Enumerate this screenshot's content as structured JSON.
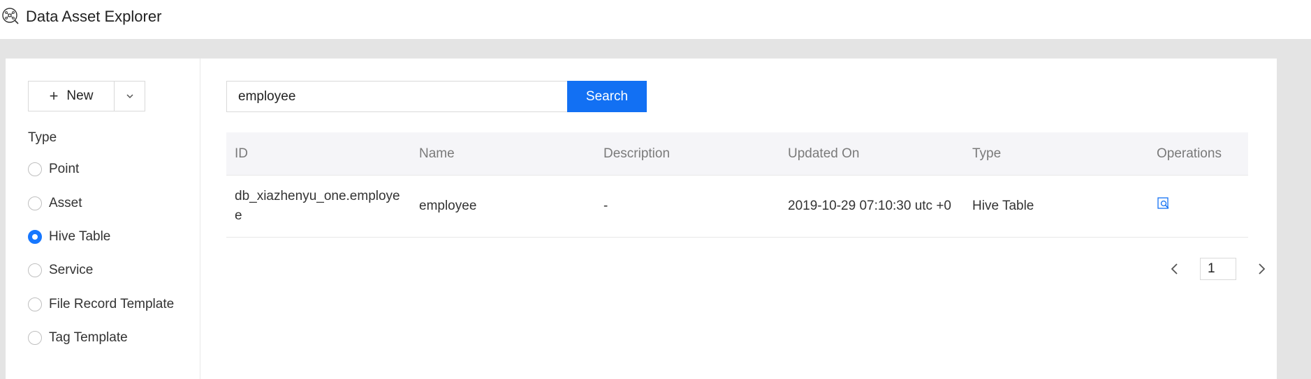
{
  "app": {
    "title": "Data Asset Explorer",
    "icon": "explorer-icon"
  },
  "sidebar": {
    "new_button": {
      "label": "New",
      "icon": "plus-icon",
      "dropdown_icon": "chevron-down-icon"
    },
    "type_heading": "Type",
    "types": [
      {
        "label": "Point",
        "checked": false
      },
      {
        "label": "Asset",
        "checked": false
      },
      {
        "label": "Hive Table",
        "checked": true
      },
      {
        "label": "Service",
        "checked": false
      },
      {
        "label": "File Record Template",
        "checked": false
      },
      {
        "label": "Tag Template",
        "checked": false
      }
    ]
  },
  "search": {
    "value": "employee",
    "button_label": "Search"
  },
  "table": {
    "columns": [
      "ID",
      "Name",
      "Description",
      "Updated On",
      "Type",
      "Operations"
    ],
    "rows": [
      {
        "id": "db_xiazhenyu_one.employee",
        "name": "employee",
        "description": "-",
        "updated_on": "2019-10-29 07:10:30 utc +0",
        "type": "Hive Table",
        "operation_icon": "view-detail-icon"
      }
    ]
  },
  "pagination": {
    "current_page": "1"
  },
  "colors": {
    "accent": "#1270f3",
    "header_bg": "#f5f5f8",
    "page_bg": "#e4e4e4"
  }
}
